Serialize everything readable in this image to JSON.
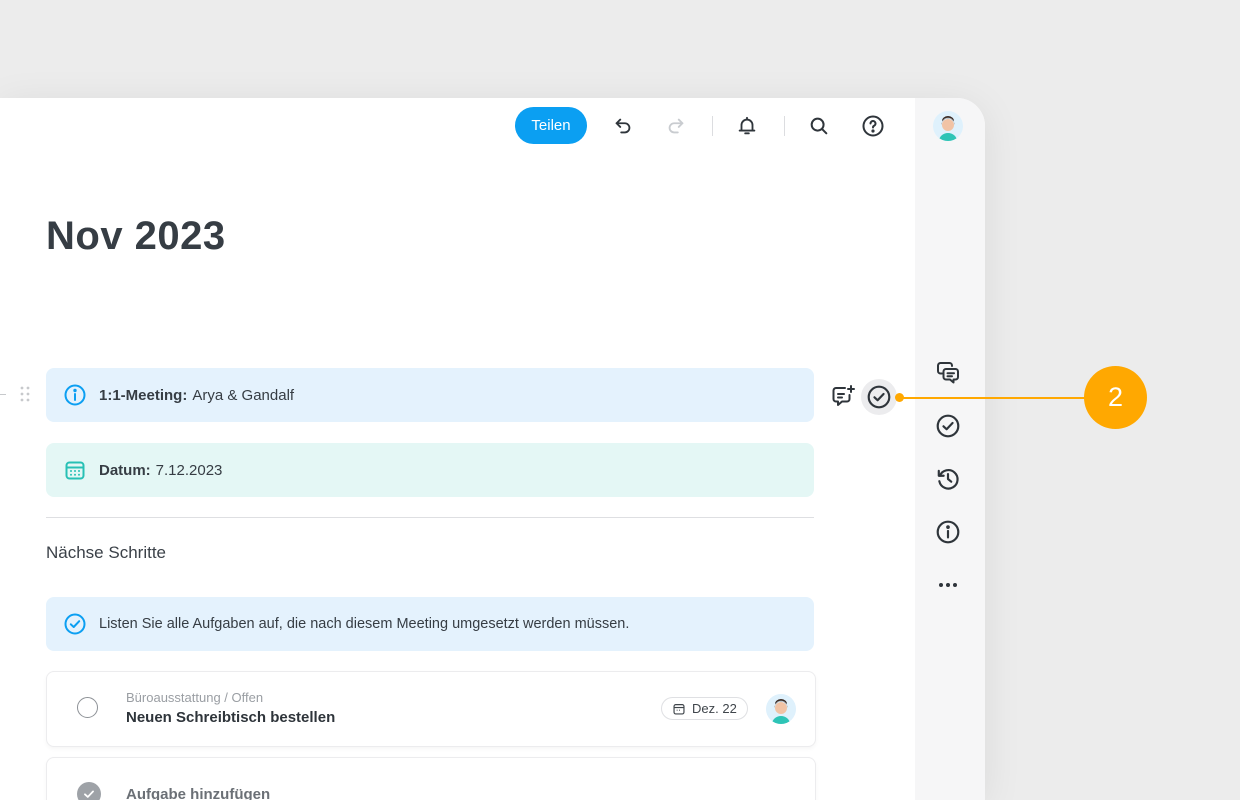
{
  "toolbar": {
    "share_label": "Teilen",
    "icons": [
      "undo-icon",
      "redo-icon",
      "bell-icon",
      "search-icon",
      "help-icon"
    ]
  },
  "document": {
    "title": "Nov 2023",
    "meeting_callout": {
      "label": "1:1-Meeting:",
      "value": "Arya & Gandalf"
    },
    "date_callout": {
      "label": "Datum:",
      "value": "7.12.2023"
    },
    "section_title": "Nächse Schritte",
    "hint_callout": "Listen Sie alle Aufgaben auf, die nach diesem Meeting umgesetzt werden müssen.",
    "task": {
      "path": "Büroausstattung / Offen",
      "name": "Neuen Schreibtisch bestellen",
      "due": "Dez. 22"
    },
    "add_task_label": "Aufgabe hinzufügen"
  },
  "sidebar": {
    "icons": [
      "comments-icon",
      "tasks-icon",
      "history-icon",
      "info-icon",
      "more-icon"
    ]
  },
  "annotation": {
    "badge_number": "2",
    "color": "#ffa801"
  },
  "colors": {
    "accent": "#0b9ff2",
    "info_bg": "#e4f2fd",
    "date_bg": "#e4f7f5",
    "teal": "#27c0b5"
  }
}
